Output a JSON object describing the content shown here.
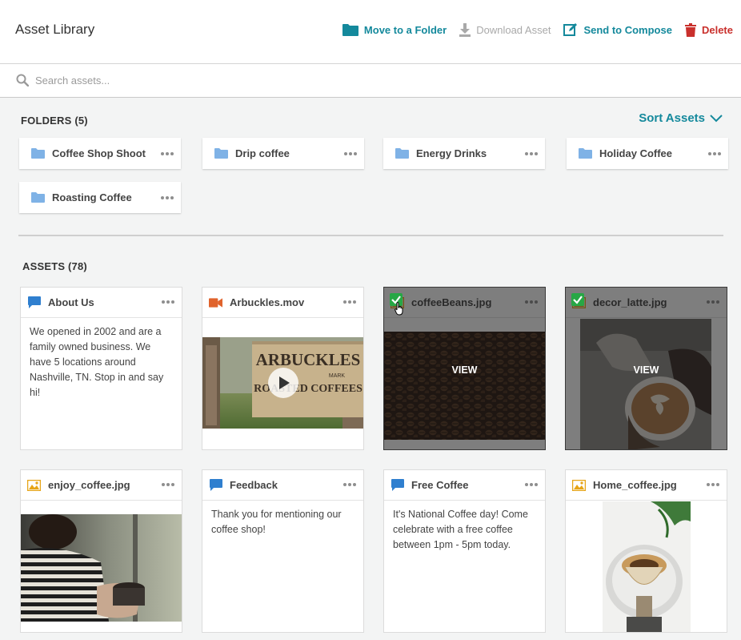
{
  "header": {
    "title": "Asset Library",
    "actions": {
      "move": "Move to a Folder",
      "download": "Download Asset",
      "compose": "Send to Compose",
      "delete": "Delete"
    }
  },
  "search": {
    "placeholder": "Search assets..."
  },
  "folders": {
    "heading": "FOLDERS (5)",
    "sort_label": "Sort Assets",
    "items": [
      {
        "name": "Coffee Shop Shoot"
      },
      {
        "name": "Drip coffee"
      },
      {
        "name": "Energy Drinks"
      },
      {
        "name": "Holiday Coffee"
      },
      {
        "name": "Roasting Coffee"
      }
    ]
  },
  "assets": {
    "heading": "ASSETS (78)",
    "view_label": "VIEW",
    "items": [
      {
        "name": "About Us",
        "type": "text",
        "icon": "chat-bubble-icon",
        "body": "We opened in 2002 and are a family owned business. We have 5 locations around Nashville, TN. Stop in and say hi!"
      },
      {
        "name": "Arbuckles.mov",
        "type": "video",
        "icon": "video-camera-icon",
        "crate_text": "ARBUCKLES",
        "crate_sub": "MARK",
        "crate_bottom": "ROASTED COFFEES"
      },
      {
        "name": "coffeeBeans.jpg",
        "type": "image",
        "icon": "image-icon",
        "selected": true
      },
      {
        "name": "decor_latte.jpg",
        "type": "image",
        "icon": "image-icon",
        "selected": true
      },
      {
        "name": "enjoy_coffee.jpg",
        "type": "image",
        "icon": "image-icon"
      },
      {
        "name": "Feedback",
        "type": "text",
        "icon": "chat-bubble-icon",
        "body": "Thank you for mentioning our coffee shop!"
      },
      {
        "name": "Free Coffee",
        "type": "text",
        "icon": "chat-bubble-icon",
        "body": "It's National Coffee day! Come celebrate with a free coffee between 1pm - 5pm today."
      },
      {
        "name": "Home_coffee.jpg",
        "type": "image",
        "icon": "image-icon"
      }
    ]
  },
  "colors": {
    "accent": "#14899c",
    "delete": "#c9302c",
    "folder_icon": "#7fb2e6",
    "chat_icon": "#2f7fcf",
    "video_icon": "#e0632c",
    "image_icon": "#e6a416",
    "check": "#27a745"
  }
}
